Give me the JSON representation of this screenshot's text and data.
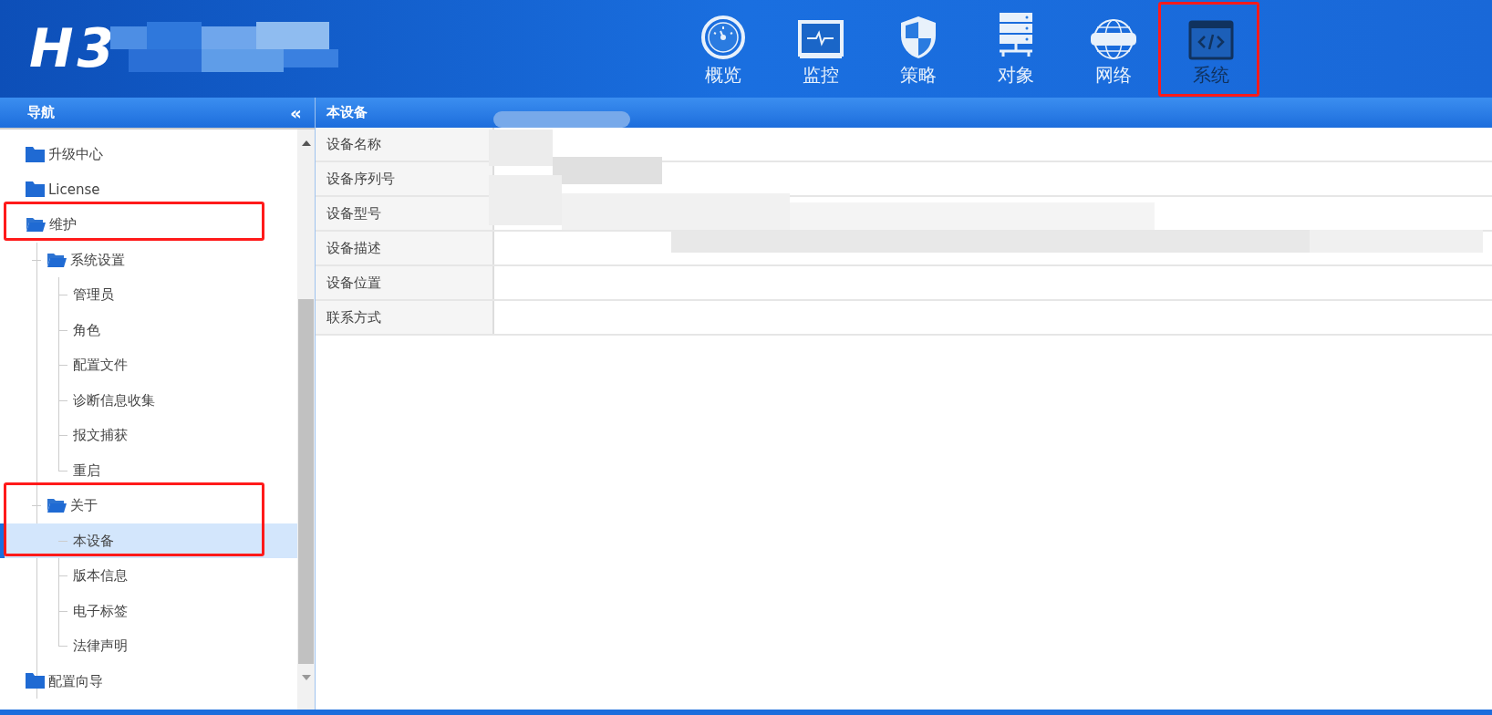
{
  "header": {
    "logo": "H3",
    "nav": [
      {
        "label": "概览",
        "kind": "gauge",
        "selected": false,
        "highlighted": false
      },
      {
        "label": "监控",
        "kind": "monitor",
        "selected": false,
        "highlighted": false
      },
      {
        "label": "策略",
        "kind": "shield",
        "selected": false,
        "highlighted": false
      },
      {
        "label": "对象",
        "kind": "server",
        "selected": false,
        "highlighted": false
      },
      {
        "label": "网络",
        "kind": "globe",
        "selected": false,
        "highlighted": false
      },
      {
        "label": "系统",
        "kind": "code",
        "selected": true,
        "highlighted": true
      }
    ]
  },
  "sidebar": {
    "title": "导航",
    "collapse": "«",
    "tree": [
      {
        "label": "升级中心",
        "expanded": false,
        "selected": false,
        "highlighted": false
      },
      {
        "label": "License",
        "expanded": false,
        "selected": false,
        "highlighted": false
      },
      {
        "label": "维护",
        "expanded": true,
        "selected": false,
        "highlighted": true,
        "children": [
          {
            "label": "系统设置",
            "expanded": true,
            "selected": false,
            "highlighted": false,
            "children": [
              {
                "label": "管理员",
                "selected": false,
                "highlighted": false
              },
              {
                "label": "角色",
                "selected": false,
                "highlighted": false
              },
              {
                "label": "配置文件",
                "selected": false,
                "highlighted": false
              },
              {
                "label": "诊断信息收集",
                "selected": false,
                "highlighted": false
              },
              {
                "label": "报文捕获",
                "selected": false,
                "highlighted": false
              },
              {
                "label": "重启",
                "selected": false,
                "highlighted": false
              }
            ]
          },
          {
            "label": "关于",
            "expanded": true,
            "selected": false,
            "highlighted": true,
            "children": [
              {
                "label": "本设备",
                "selected": true,
                "highlighted": true
              },
              {
                "label": "版本信息",
                "selected": false,
                "highlighted": false
              },
              {
                "label": "电子标签",
                "selected": false,
                "highlighted": false
              },
              {
                "label": "法律声明",
                "selected": false,
                "highlighted": false
              }
            ]
          }
        ]
      },
      {
        "label": "配置向导",
        "expanded": false,
        "selected": false,
        "highlighted": false
      }
    ]
  },
  "panel": {
    "title": "本设备",
    "rows": [
      {
        "label": "设备名称"
      },
      {
        "label": "设备序列号"
      },
      {
        "label": "设备型号"
      },
      {
        "label": "设备描述"
      },
      {
        "label": "设备位置"
      },
      {
        "label": "联系方式"
      }
    ]
  }
}
